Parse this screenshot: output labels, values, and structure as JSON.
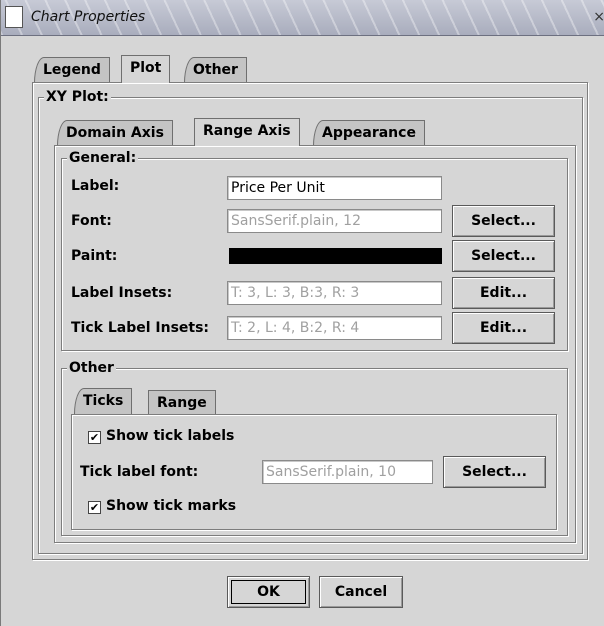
{
  "window": {
    "title": "Chart Properties",
    "close_glyph": "×"
  },
  "top_tabs": [
    "Legend",
    "Plot",
    "Other"
  ],
  "xy_plot": {
    "legend": "XY Plot:",
    "axis_tabs": [
      "Domain Axis",
      "Range Axis",
      "Appearance"
    ],
    "general": {
      "legend": "General:",
      "label_label": "Label:",
      "label_value": "Price Per Unit",
      "font_label": "Font:",
      "font_value": "SansSerif.plain, 12",
      "paint_label": "Paint:",
      "paint_color": "#000000",
      "label_insets_label": "Label Insets:",
      "label_insets_value": "T: 3, L: 3, B:3, R: 3",
      "tick_label_insets_label": "Tick Label Insets:",
      "tick_label_insets_value": "T: 2, L: 4, B:2, R: 4",
      "select_label": "Select...",
      "edit_label": "Edit..."
    },
    "other": {
      "legend": "Other",
      "tabs": [
        "Ticks",
        "Range"
      ],
      "show_tick_labels": "Show tick labels",
      "tick_label_font_label": "Tick label font:",
      "tick_label_font_value": "SansSerif.plain, 10",
      "select_label": "Select...",
      "show_tick_marks": "Show tick marks",
      "check_glyph": "✔"
    }
  },
  "buttons": {
    "ok": "OK",
    "cancel": "Cancel"
  }
}
